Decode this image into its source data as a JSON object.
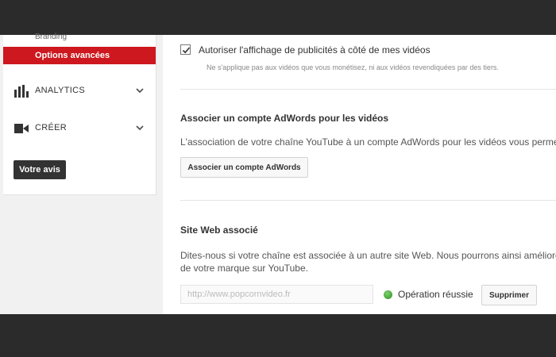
{
  "sidebar": {
    "branding_label": "Branding",
    "active_item": "Options avancées",
    "items": [
      {
        "label": "ANALYTICS",
        "icon": "bar-chart-icon"
      },
      {
        "label": "CRÉER",
        "icon": "video-camera-icon"
      }
    ],
    "feedback_button": "Votre avis"
  },
  "ads": {
    "checkbox_checked": true,
    "checkbox_label": "Autoriser l'affichage de publicités à côté de mes vidéos",
    "note": "Ne s'applique pas aux vidéos que vous monétisez, ni aux vidéos revendiquées par des tiers."
  },
  "adwords": {
    "title": "Associer un compte AdWords pour les vidéos",
    "text": "L'association de votre chaîne YouTube à un compte AdWords pour les vidéos vous permet",
    "button": "Associer un compte AdWords"
  },
  "website": {
    "title": "Site Web associé",
    "text_line1": "Dites-nous si votre chaîne est associée à un autre site Web. Nous pourrons ainsi améliorer",
    "text_line2": "de votre marque sur YouTube.",
    "input_placeholder": "http://www.popcornvideo.fr",
    "status_text": "Opération réussie",
    "status_color": "#3c9e2d",
    "delete_button": "Supprimer"
  },
  "colors": {
    "accent": "#cc181e",
    "topbar": "#2b2b2b",
    "feedback_button_bg": "#333333"
  }
}
